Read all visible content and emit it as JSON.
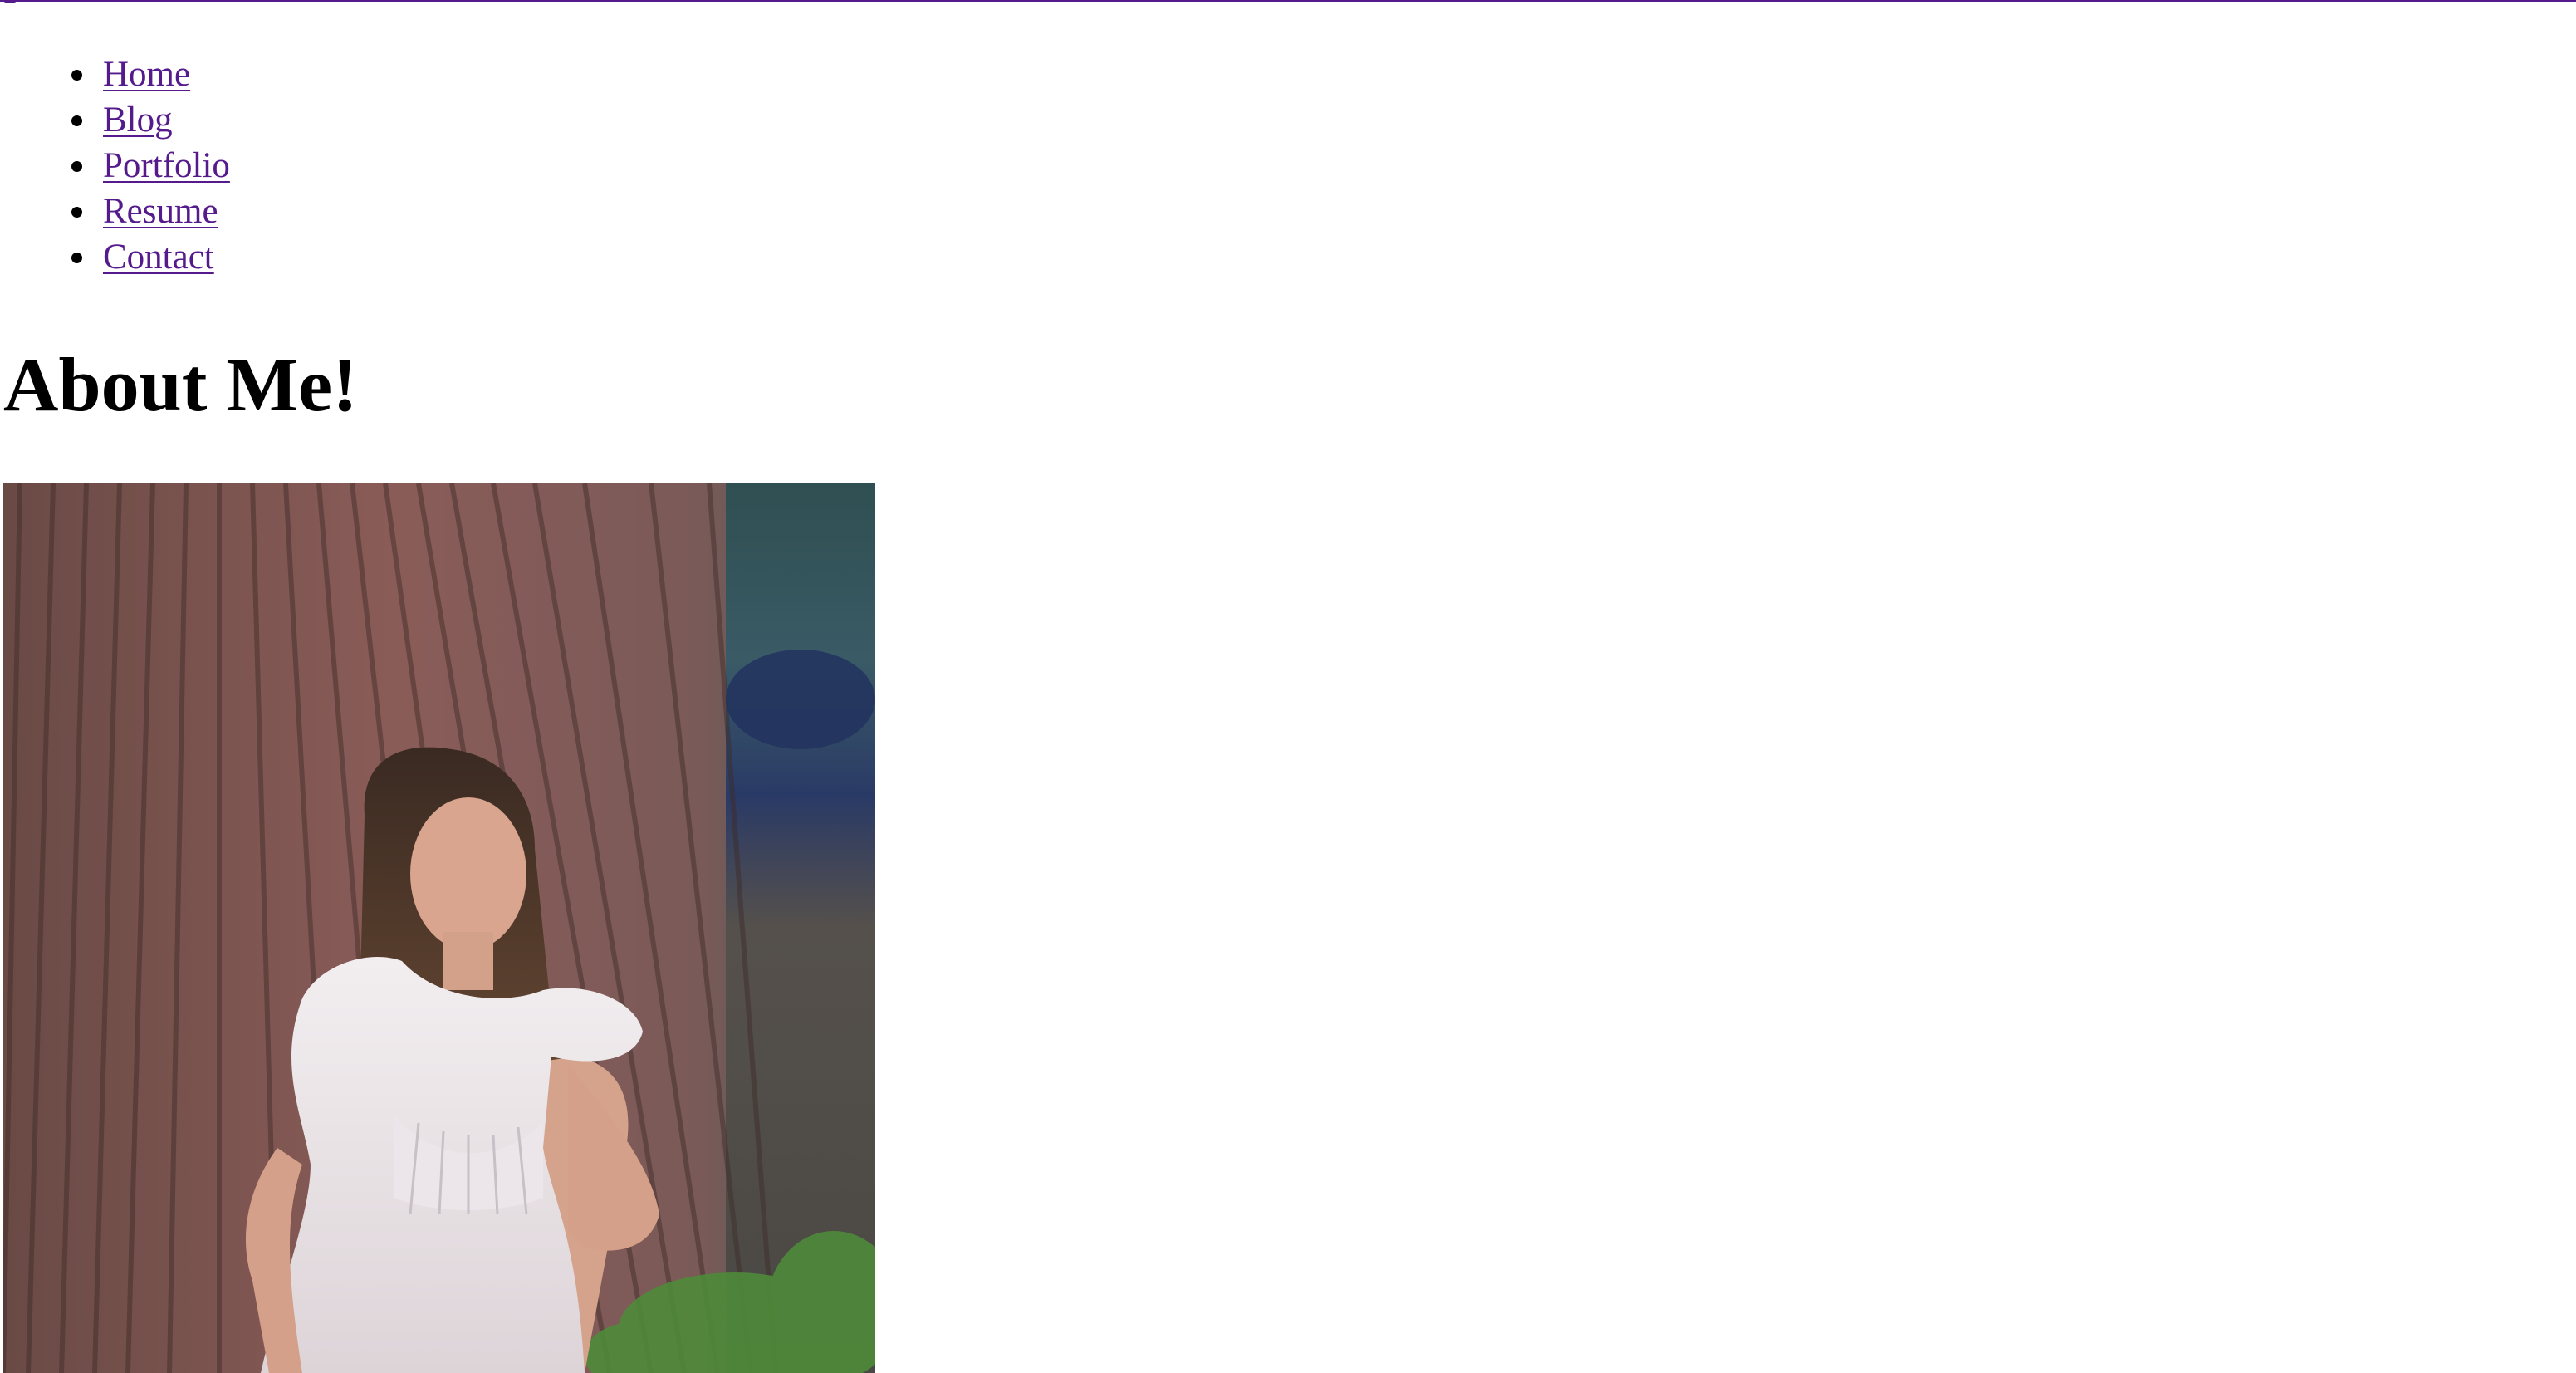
{
  "nav": {
    "items": [
      {
        "label": "Home"
      },
      {
        "label": "Blog"
      },
      {
        "label": "Portfolio"
      },
      {
        "label": "Resume"
      },
      {
        "label": "Contact"
      }
    ]
  },
  "main": {
    "title": "About Me!"
  },
  "colors": {
    "link": "#551a8b",
    "text": "#000000",
    "background": "#ffffff"
  }
}
